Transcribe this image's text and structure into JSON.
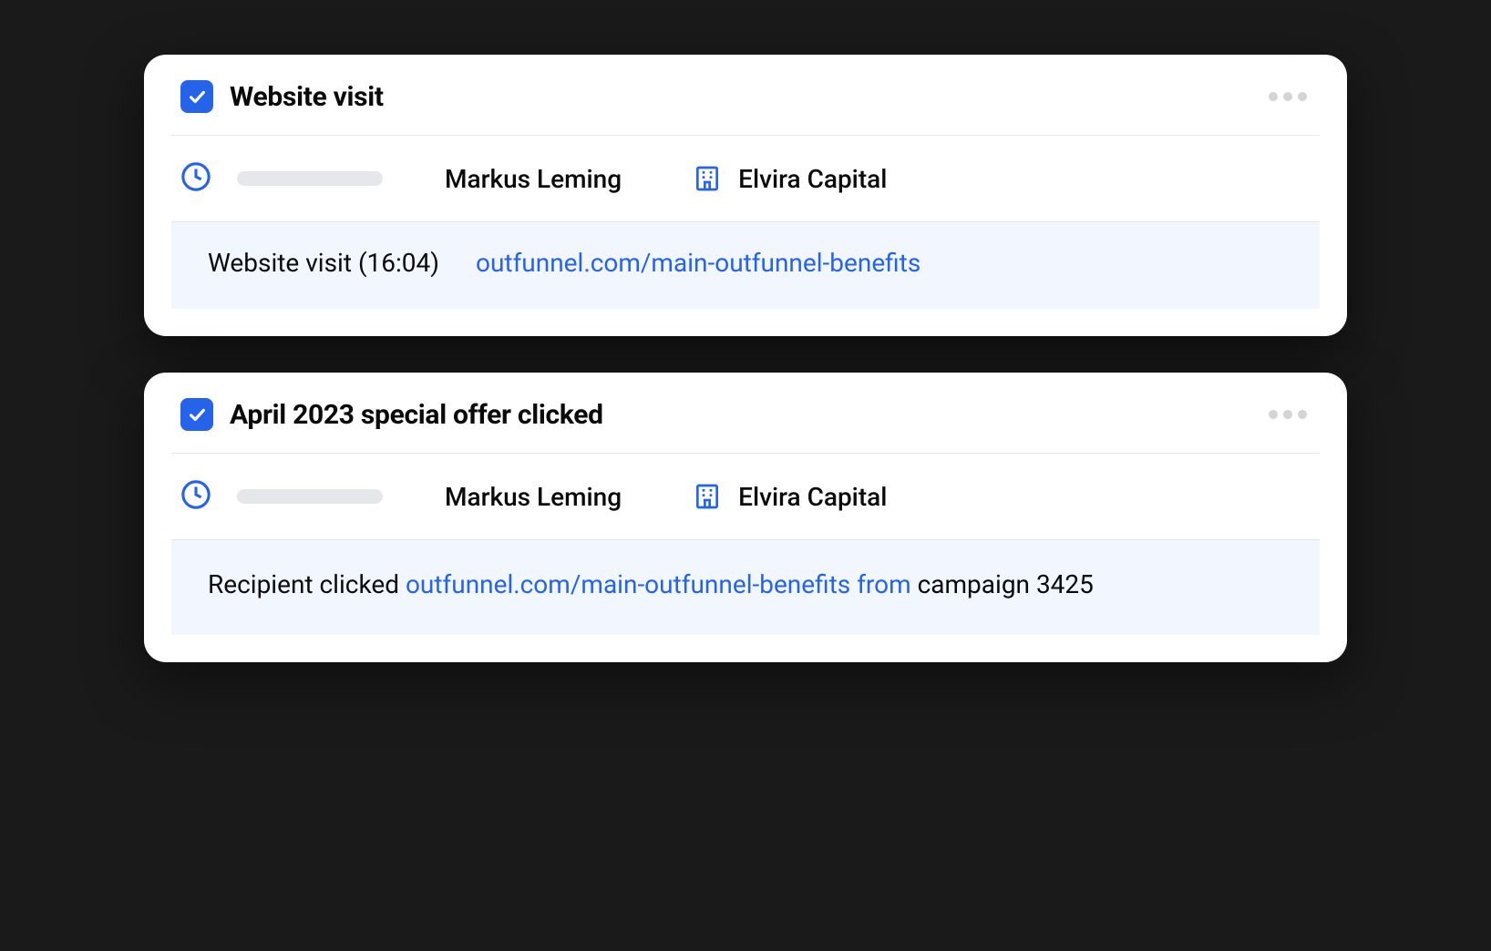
{
  "cards": [
    {
      "title": "Website visit",
      "contact_name": "Markus Leming",
      "company_name": "Elvira Capital",
      "detail": {
        "label": "Website visit (16:04)",
        "link": "outfunnel.com/main-outfunnel-benefits"
      }
    },
    {
      "title": "April 2023 special offer clicked",
      "contact_name": "Markus Leming",
      "company_name": "Elvira Capital",
      "detail_inline": {
        "prefix": "Recipient clicked ",
        "link": "outfunnel.com/main-outfunnel-benefits from ",
        "suffix": "campaign 3425"
      }
    }
  ]
}
